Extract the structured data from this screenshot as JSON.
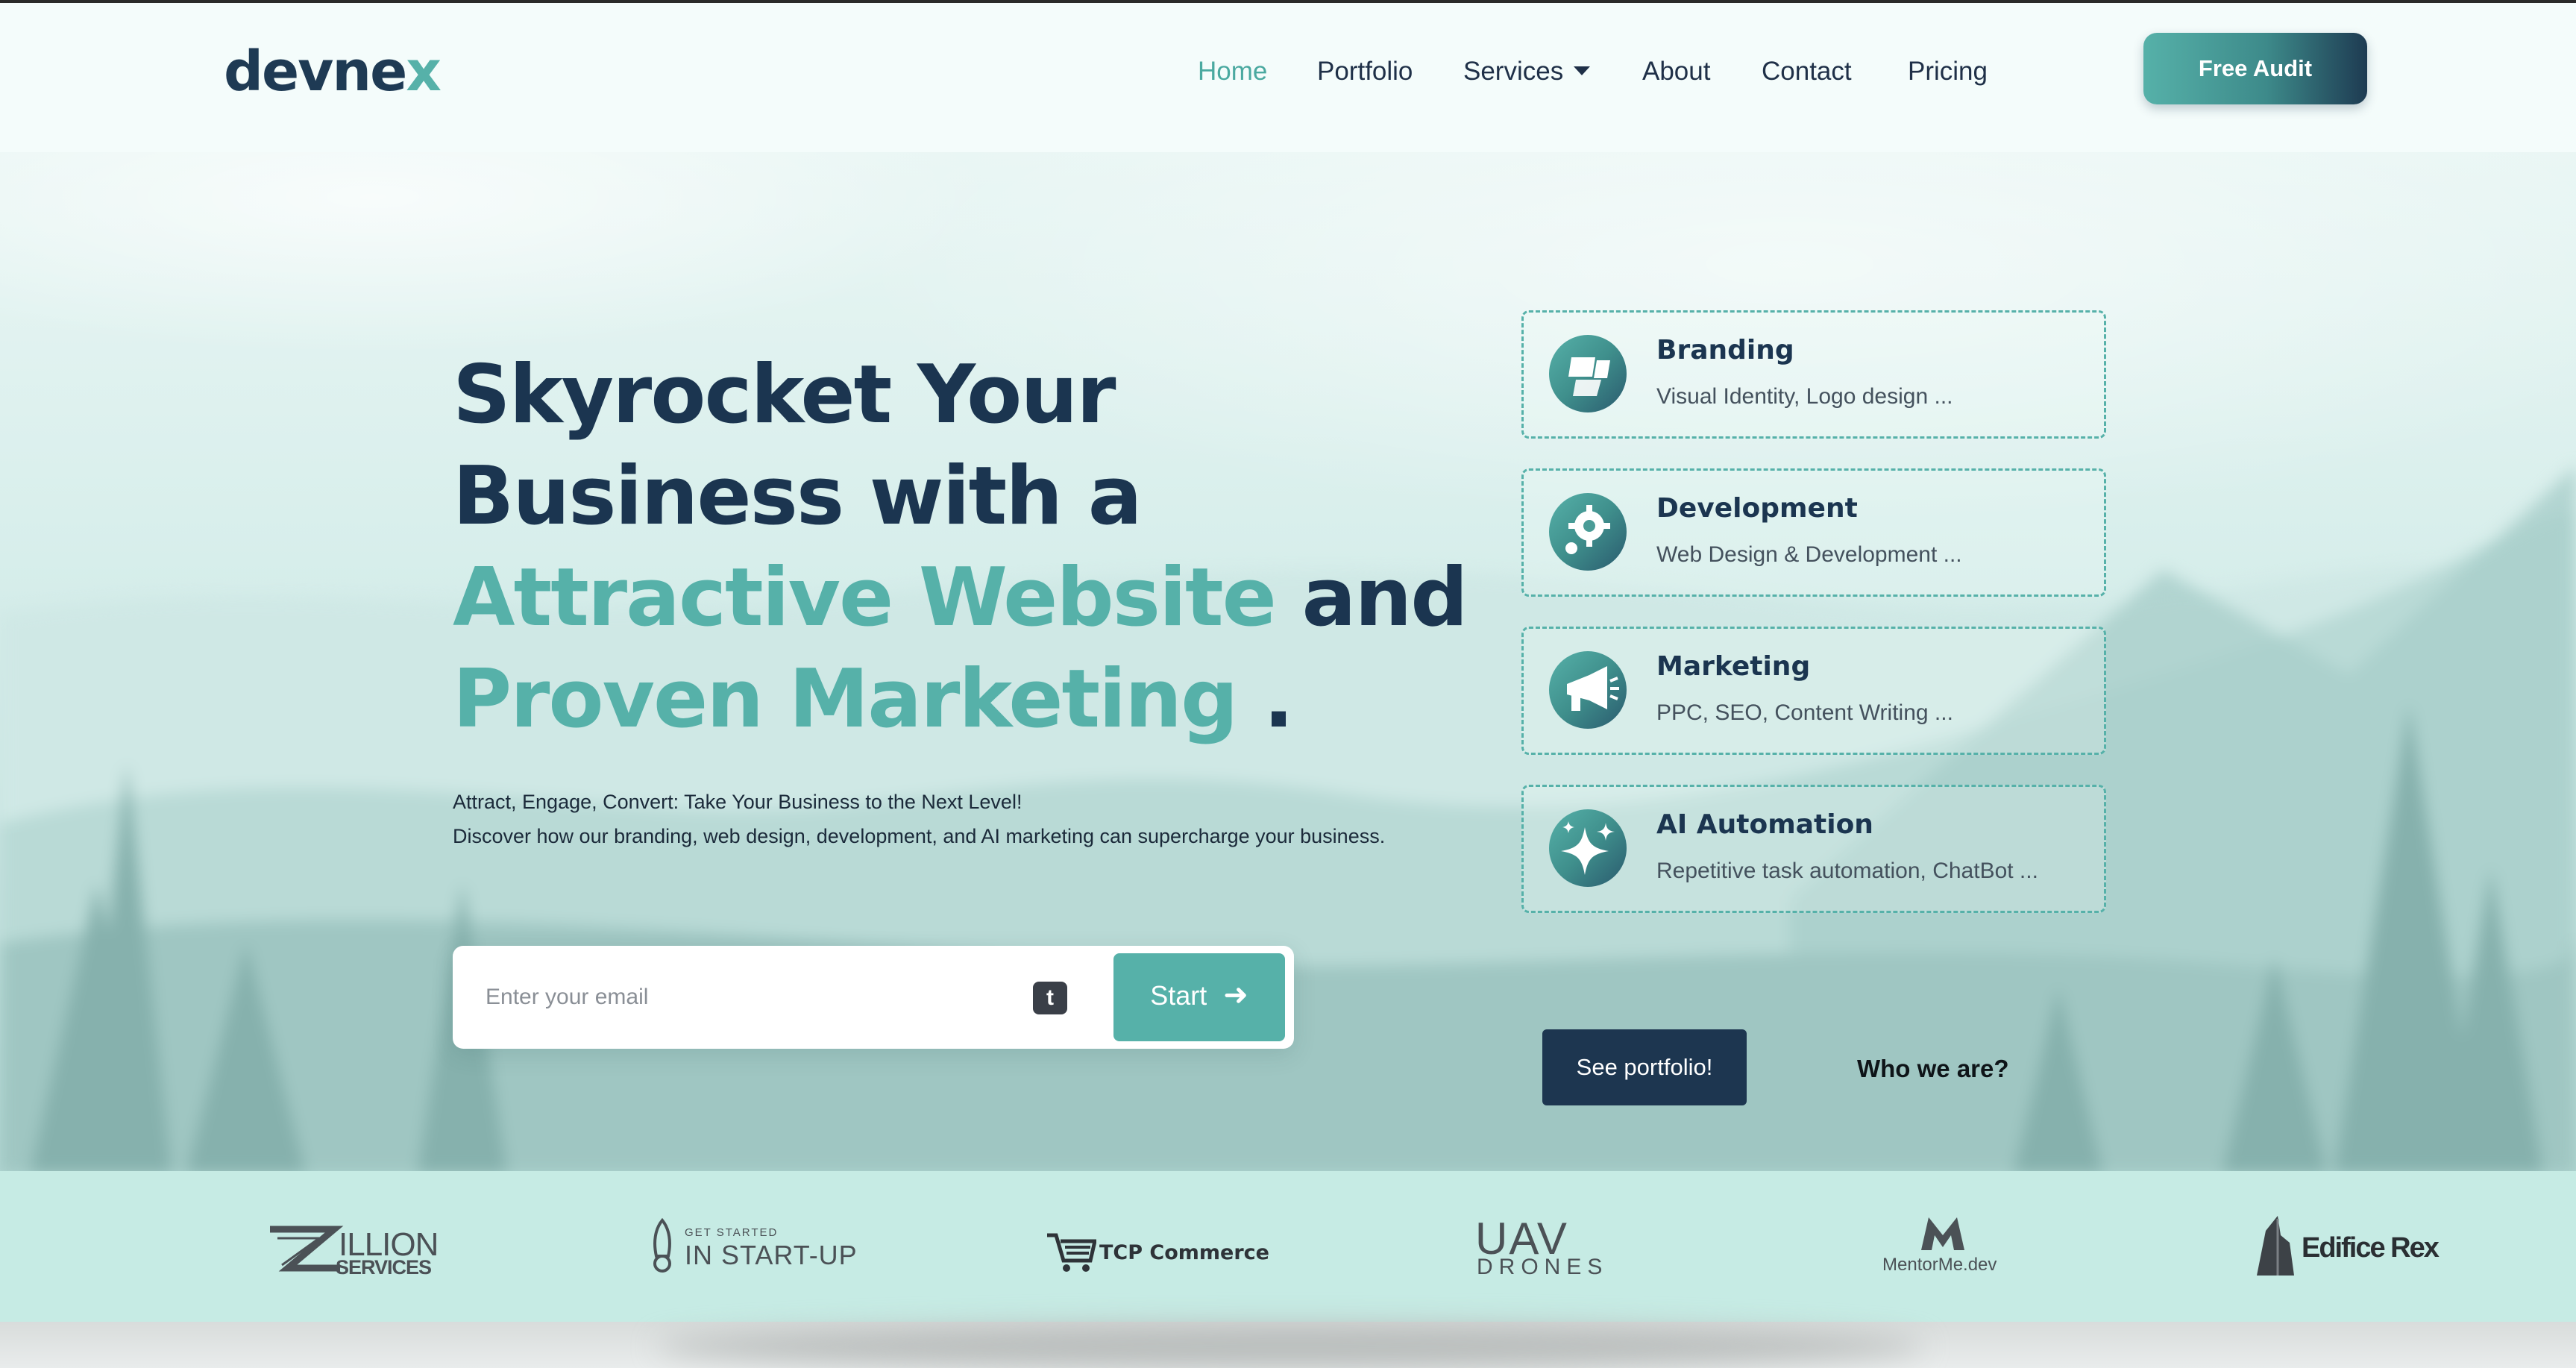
{
  "brand": {
    "logo_main": "devne",
    "logo_accent": "x"
  },
  "nav": {
    "items": [
      {
        "label": "Home",
        "active": true
      },
      {
        "label": "Portfolio",
        "active": false
      },
      {
        "label": "Services",
        "active": false,
        "dropdown": true
      },
      {
        "label": "About",
        "active": false
      },
      {
        "label": "Contact",
        "active": false
      },
      {
        "label": "Pricing",
        "active": false
      }
    ],
    "cta_label": "Free Audit"
  },
  "hero": {
    "headline_line1": "Skyrocket Your",
    "headline_line2": "Business with a",
    "headline_accent1": "Attractive Website",
    "headline_and": " and",
    "headline_accent2": "Proven Marketing",
    "headline_period": " .",
    "subtext_line1": "Attract, Engage, Convert: Take Your Business to the Next Level!",
    "subtext_line2": "Discover how our branding, web design, development, and AI marketing can supercharge your business.",
    "email_placeholder": "Enter your email",
    "extension_icon_letter": "t",
    "start_label": "Start"
  },
  "services": [
    {
      "title": "Branding",
      "subtitle": "Visual Identity, Logo design ...",
      "icon": "branding-icon"
    },
    {
      "title": "Development",
      "subtitle": "Web Design & Development ...",
      "icon": "gear-icon"
    },
    {
      "title": "Marketing",
      "subtitle": "PPC, SEO, Content Writing ...",
      "icon": "megaphone-icon"
    },
    {
      "title": "AI Automation",
      "subtitle": "Repetitive task automation, ChatBot ...",
      "icon": "sparkles-icon"
    }
  ],
  "cta": {
    "portfolio_label": "See portfolio!",
    "who_label": "Who we are?"
  },
  "clients": {
    "zillion_main": "ILLION",
    "zillion_sub": "SERVICES",
    "startup_small": "GET STARTED",
    "startup_main": "IN START-UP",
    "tcp": "TCP Commerce",
    "uav_main": "UAV",
    "uav_sub": "DRONES",
    "mentor": "MentorMe.dev",
    "edifice": "Edifice Rex"
  },
  "colors": {
    "navy": "#1b3550",
    "teal": "#56b1a9",
    "strip": "#c6ebe4",
    "page_bg": "#f3fbfa"
  }
}
